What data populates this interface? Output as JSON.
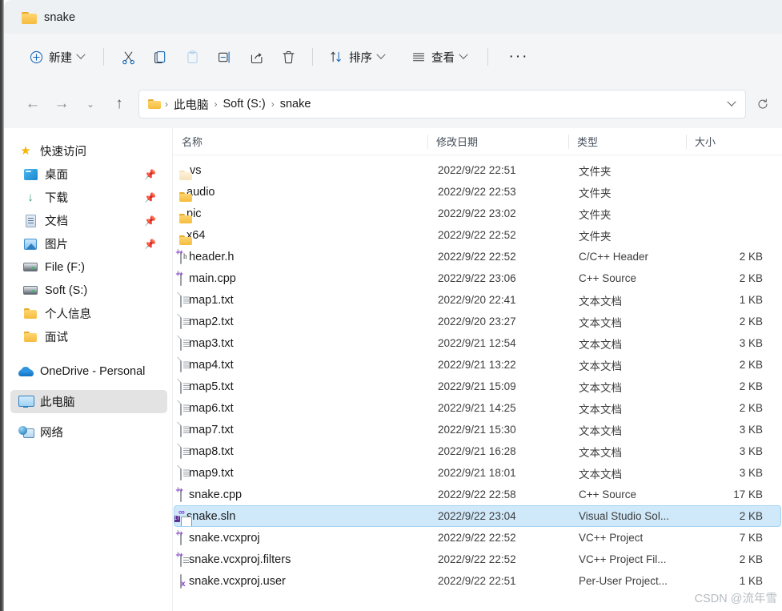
{
  "window": {
    "tab_title": "snake",
    "tab_icon": "folder-icon"
  },
  "toolbar": {
    "new_label": "新建",
    "cut_label": "剪切",
    "copy_label": "复制",
    "paste_label": "粘贴",
    "rename_label": "重命名",
    "share_label": "共享",
    "delete_label": "删除",
    "sort_label": "排序",
    "view_label": "查看",
    "more_label": "···"
  },
  "addressbar": {
    "back_label": "←",
    "forward_label": "→",
    "recent_label": "⌄",
    "up_label": "↑",
    "refresh_label": "↻",
    "dropdown_label": "⌄",
    "crumbs": [
      "此电脑",
      "Soft (S:)",
      "snake"
    ],
    "crumb_separator": "›"
  },
  "sidebar": {
    "items": [
      {
        "label": "快速访问",
        "icon": "star-icon",
        "pinned": false,
        "selected": false,
        "root": true
      },
      {
        "label": "桌面",
        "icon": "desktop-icon",
        "pinned": true,
        "selected": false,
        "root": false
      },
      {
        "label": "下载",
        "icon": "download-icon",
        "pinned": true,
        "selected": false,
        "root": false
      },
      {
        "label": "文档",
        "icon": "document-icon",
        "pinned": true,
        "selected": false,
        "root": false
      },
      {
        "label": "图片",
        "icon": "pictures-icon",
        "pinned": true,
        "selected": false,
        "root": false
      },
      {
        "label": "File (F:)",
        "icon": "drive-icon",
        "pinned": false,
        "selected": false,
        "root": false
      },
      {
        "label": "Soft (S:)",
        "icon": "drive-icon",
        "pinned": false,
        "selected": false,
        "root": false
      },
      {
        "label": "个人信息",
        "icon": "folder-icon",
        "pinned": false,
        "selected": false,
        "root": false
      },
      {
        "label": "面试",
        "icon": "folder-icon",
        "pinned": false,
        "selected": false,
        "root": false
      }
    ],
    "roots": [
      {
        "label": "OneDrive - Personal",
        "icon": "onedrive-icon",
        "selected": false
      },
      {
        "label": "此电脑",
        "icon": "this-pc-icon",
        "selected": true
      },
      {
        "label": "网络",
        "icon": "network-icon",
        "selected": false
      }
    ],
    "pin_glyph": "📌"
  },
  "filelist": {
    "columns": [
      {
        "key": "name",
        "label": "名称",
        "sorted": "asc"
      },
      {
        "key": "date",
        "label": "修改日期",
        "sorted": null
      },
      {
        "key": "type",
        "label": "类型",
        "sorted": null
      },
      {
        "key": "size",
        "label": "大小",
        "sorted": null
      }
    ],
    "sort_caret": "⌃",
    "rows": [
      {
        "name": ".vs",
        "date": "2022/9/22 22:51",
        "type": "文件夹",
        "size": "",
        "icon": "folder-hidden-icon",
        "selected": false
      },
      {
        "name": "audio",
        "date": "2022/9/22 22:53",
        "type": "文件夹",
        "size": "",
        "icon": "folder-icon",
        "selected": false
      },
      {
        "name": "pic",
        "date": "2022/9/22 23:02",
        "type": "文件夹",
        "size": "",
        "icon": "folder-icon",
        "selected": false
      },
      {
        "name": "x64",
        "date": "2022/9/22 22:52",
        "type": "文件夹",
        "size": "",
        "icon": "folder-icon",
        "selected": false
      },
      {
        "name": "header.h",
        "date": "2022/9/22 22:52",
        "type": "C/C++ Header",
        "size": "2 KB",
        "icon": "c-header-icon",
        "selected": false
      },
      {
        "name": "main.cpp",
        "date": "2022/9/22 23:06",
        "type": "C++ Source",
        "size": "2 KB",
        "icon": "cpp-source-icon",
        "selected": false
      },
      {
        "name": "map1.txt",
        "date": "2022/9/20 22:41",
        "type": "文本文档",
        "size": "1 KB",
        "icon": "text-file-icon",
        "selected": false
      },
      {
        "name": "map2.txt",
        "date": "2022/9/20 23:27",
        "type": "文本文档",
        "size": "2 KB",
        "icon": "text-file-icon",
        "selected": false
      },
      {
        "name": "map3.txt",
        "date": "2022/9/21 12:54",
        "type": "文本文档",
        "size": "3 KB",
        "icon": "text-file-icon",
        "selected": false
      },
      {
        "name": "map4.txt",
        "date": "2022/9/21 13:22",
        "type": "文本文档",
        "size": "2 KB",
        "icon": "text-file-icon",
        "selected": false
      },
      {
        "name": "map5.txt",
        "date": "2022/9/21 15:09",
        "type": "文本文档",
        "size": "2 KB",
        "icon": "text-file-icon",
        "selected": false
      },
      {
        "name": "map6.txt",
        "date": "2022/9/21 14:25",
        "type": "文本文档",
        "size": "2 KB",
        "icon": "text-file-icon",
        "selected": false
      },
      {
        "name": "map7.txt",
        "date": "2022/9/21 15:30",
        "type": "文本文档",
        "size": "3 KB",
        "icon": "text-file-icon",
        "selected": false
      },
      {
        "name": "map8.txt",
        "date": "2022/9/21 16:28",
        "type": "文本文档",
        "size": "3 KB",
        "icon": "text-file-icon",
        "selected": false
      },
      {
        "name": "map9.txt",
        "date": "2022/9/21 18:01",
        "type": "文本文档",
        "size": "3 KB",
        "icon": "text-file-icon",
        "selected": false
      },
      {
        "name": "snake.cpp",
        "date": "2022/9/22 22:58",
        "type": "C++ Source",
        "size": "17 KB",
        "icon": "cpp-source-icon",
        "selected": false
      },
      {
        "name": "snake.sln",
        "date": "2022/9/22 23:04",
        "type": "Visual Studio Sol...",
        "size": "2 KB",
        "icon": "vs-solution-icon",
        "selected": true
      },
      {
        "name": "snake.vcxproj",
        "date": "2022/9/22 22:52",
        "type": "VC++ Project",
        "size": "7 KB",
        "icon": "vcxproj-icon",
        "selected": false
      },
      {
        "name": "snake.vcxproj.filters",
        "date": "2022/9/22 22:52",
        "type": "VC++ Project Fil...",
        "size": "2 KB",
        "icon": "vcxproj-filters-icon",
        "selected": false
      },
      {
        "name": "snake.vcxproj.user",
        "date": "2022/9/22 22:51",
        "type": "Per-User Project...",
        "size": "1 KB",
        "icon": "vcxproj-user-icon",
        "selected": false
      }
    ]
  },
  "watermark": {
    "text": "CSDN @流年雪"
  },
  "colors": {
    "selection": "#cfe8fa",
    "selection_border": "#a7d4f2",
    "chrome": "#f3f5f7",
    "titlebar": "#eef1f4",
    "accent": "#0f6cbd",
    "folder": "#f5bc3e"
  }
}
